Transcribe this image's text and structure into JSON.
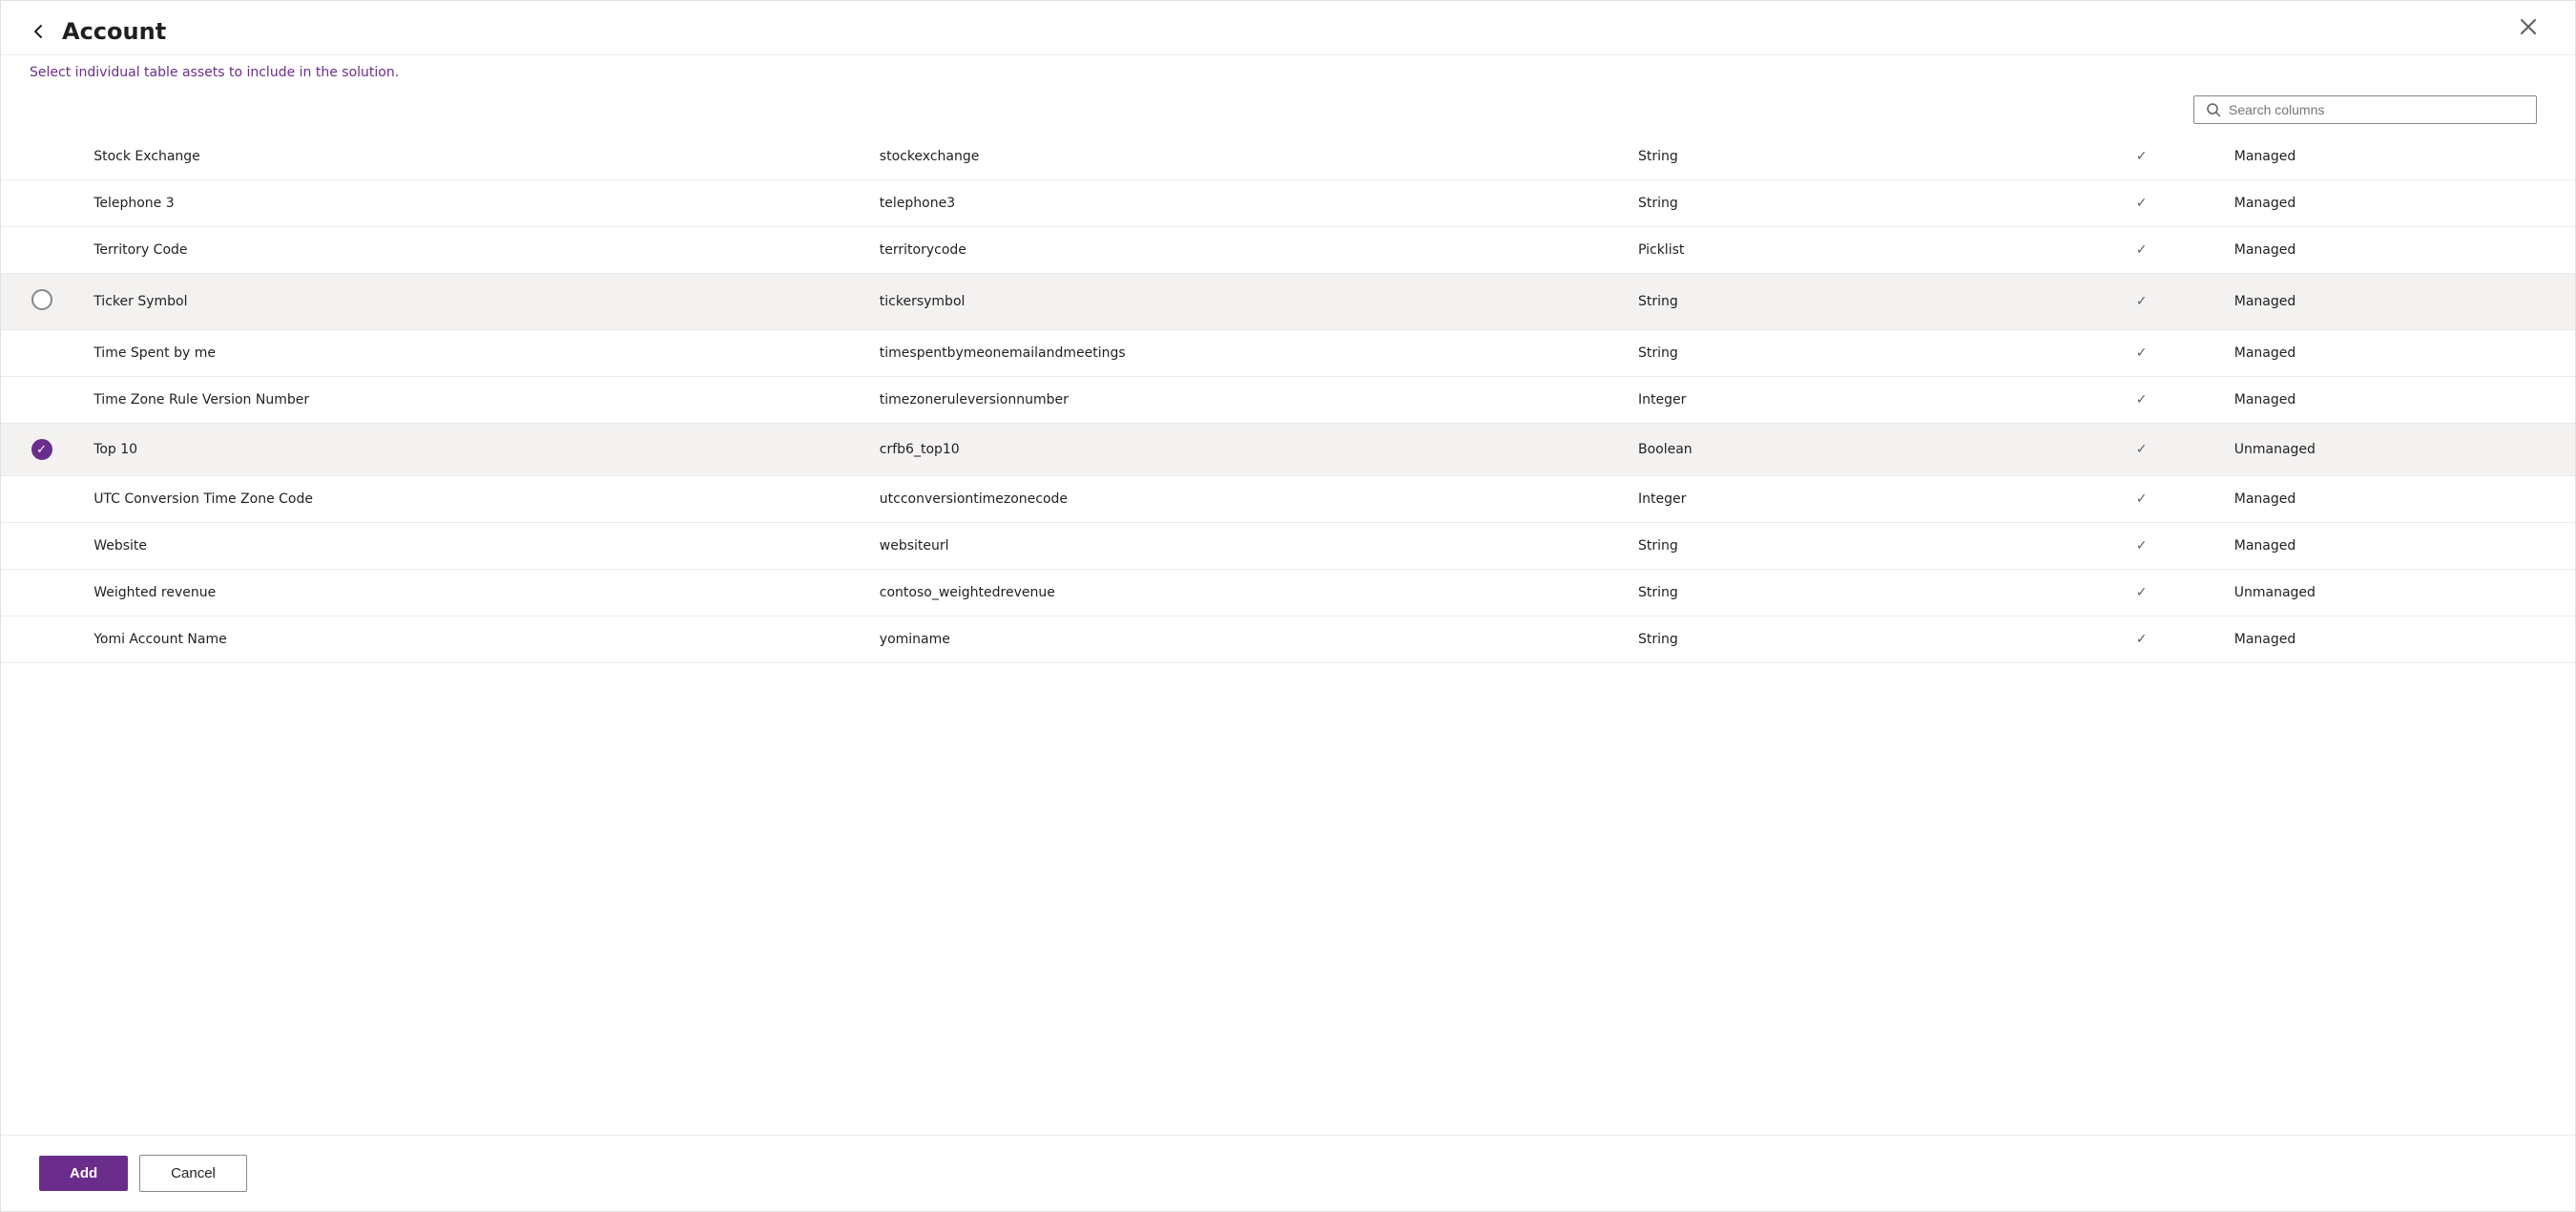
{
  "header": {
    "title": "Account",
    "back_label": "←",
    "close_label": "✕"
  },
  "subtitle": {
    "text_plain": "Select ",
    "text_highlight": "individual table assets",
    "text_after": " to include in the solution."
  },
  "search": {
    "placeholder": "Search columns",
    "value": ""
  },
  "rows": [
    {
      "id": 1,
      "name": "Stock Exchange",
      "logical": "stockexchange",
      "type": "String",
      "hasCheck": true,
      "managed": "Managed",
      "selected": false
    },
    {
      "id": 2,
      "name": "Telephone 3",
      "logical": "telephone3",
      "type": "String",
      "hasCheck": true,
      "managed": "Managed",
      "selected": false
    },
    {
      "id": 3,
      "name": "Territory Code",
      "logical": "territorycode",
      "type": "Picklist",
      "hasCheck": true,
      "managed": "Managed",
      "selected": false
    },
    {
      "id": 4,
      "name": "Ticker Symbol",
      "logical": "tickersymbol",
      "type": "String",
      "hasCheck": true,
      "managed": "Managed",
      "selected": false,
      "highlight": true
    },
    {
      "id": 5,
      "name": "Time Spent by me",
      "logical": "timespentbymeonemailandmeetings",
      "type": "String",
      "hasCheck": true,
      "managed": "Managed",
      "selected": false
    },
    {
      "id": 6,
      "name": "Time Zone Rule Version Number",
      "logical": "timezoneruleversionnumber",
      "type": "Integer",
      "hasCheck": true,
      "managed": "Managed",
      "selected": false
    },
    {
      "id": 7,
      "name": "Top 10",
      "logical": "crfb6_top10",
      "type": "Boolean",
      "hasCheck": true,
      "managed": "Unmanaged",
      "selected": true,
      "highlight": true
    },
    {
      "id": 8,
      "name": "UTC Conversion Time Zone Code",
      "logical": "utcconversiontimezonecode",
      "type": "Integer",
      "hasCheck": true,
      "managed": "Managed",
      "selected": false
    },
    {
      "id": 9,
      "name": "Website",
      "logical": "websiteurl",
      "type": "String",
      "hasCheck": true,
      "managed": "Managed",
      "selected": false
    },
    {
      "id": 10,
      "name": "Weighted revenue",
      "logical": "contoso_weightedrevenue",
      "type": "String",
      "hasCheck": true,
      "managed": "Unmanaged",
      "selected": false
    },
    {
      "id": 11,
      "name": "Yomi Account Name",
      "logical": "yominame",
      "type": "String",
      "hasCheck": true,
      "managed": "Managed",
      "selected": false
    }
  ],
  "footer": {
    "add_label": "Add",
    "cancel_label": "Cancel"
  }
}
